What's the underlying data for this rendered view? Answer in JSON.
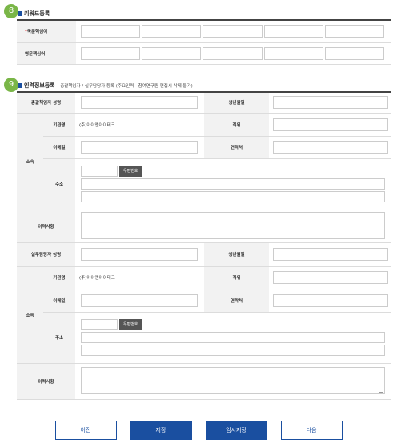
{
  "keyword": {
    "badge": "8",
    "title": "키워드등록",
    "korean_label_mark": "*",
    "korean_label": "국문핵심어",
    "english_label": "영문핵심어"
  },
  "personnel": {
    "badge": "9",
    "title": "인력정보등록",
    "subtitle": "| 총괄책임자 / 실무담당자 등록 (주요인력 - 참여연구원 편집시 삭제 불가)",
    "chief": {
      "name_label": "총괄책임자 성명",
      "birth_label": "생년월일",
      "affiliation_label": "소속",
      "org_label": "기관명",
      "org_value": "(주)아이엔아이테크",
      "position_label": "직위",
      "email_label": "이메일",
      "contact_label": "연락처",
      "address_label": "주소",
      "postcode_button": "우편번호",
      "career_label": "이력사항"
    },
    "staff": {
      "name_label": "실무담당자 성명",
      "birth_label": "생년월일",
      "affiliation_label": "소속",
      "org_label": "기관명",
      "org_value": "(주)아이엔아이테크",
      "position_label": "직위",
      "email_label": "이메일",
      "contact_label": "연락처",
      "address_label": "주소",
      "postcode_button": "우편번호",
      "career_label": "이력사항"
    }
  },
  "buttons": {
    "prev": "이전",
    "save": "저장",
    "temp_save": "임시저장",
    "next": "다음"
  },
  "colors": {
    "accent": "#1a4fa0",
    "badge": "#7ab648",
    "required": "#e53333"
  }
}
